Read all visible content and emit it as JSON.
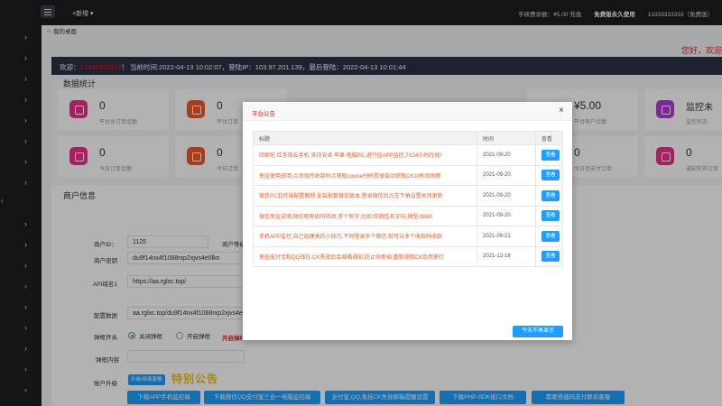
{
  "topbar": {
    "new_label": "+新增 ▾",
    "balance": "手续费余额：¥5.00 充值",
    "free_version": "免费版永久使用",
    "user": "13333333333（免费版）"
  },
  "tabs": {
    "home": "我的桌面"
  },
  "hello": "您好，欢迎",
  "welcome": {
    "prefix": "欢迎：",
    "username": "13333333333",
    "suffix": "！ 当前时间:2022-04-13 10:02:07，登陆IP：103.97.201.139，最后登陆：2022-04-13 10:01:44"
  },
  "stats": {
    "title": "数据统计",
    "cards": [
      {
        "value": "0",
        "label": "平台总订单金额",
        "icon": "bag-icon"
      },
      {
        "value": "0",
        "label": "平台订单",
        "icon": "face-icon"
      },
      {
        "value": "¥5.00",
        "label": "平台账户余额",
        "icon": "wallet-icon"
      },
      {
        "value": "监控未",
        "label": "监控状态",
        "icon": "heart-icon"
      },
      {
        "value": "0",
        "label": "今日订单金额",
        "icon": "bag-icon"
      },
      {
        "value": "0",
        "label": "今日订单",
        "icon": "face-icon"
      },
      {
        "value": "0",
        "label": "今日待支付订单",
        "icon": "clock-icon"
      },
      {
        "value": "0",
        "label": "通知失败订单",
        "icon": "bird-icon"
      }
    ]
  },
  "merchant": {
    "title": "商户信息",
    "id_label": "商户ID：",
    "id_value": "1125",
    "level_label": "商户等级",
    "key_label": "商户密钥",
    "key_value": "du9f14nx4f1088rxp2xjvs4e0lkn",
    "api_label": "API域名1",
    "api_value": "https://aa.rglxc.top/",
    "config_label": "配置数据",
    "config_value": "aa.rglxc.top/du9f14nx4f1088rxp2xjvs4e0",
    "popup_switch_label": "弹框开关",
    "popup_off": "关闭弹框",
    "popup_on": "开启弹框",
    "popup_hint": "开启弹框",
    "popup_content_label": "弹框内容",
    "upgrade_label": "账户升级",
    "upgrade_small": "升级/续费套餐",
    "promo": "特别公告",
    "buttons": [
      "下载APP手机监控端",
      "下载微信QQ支付宝三合一电脑监控端",
      "支付宝,QQ,免挂CK失效邮箱提醒设置",
      "下载PHP-SDK接口文档",
      "需要搭建码支付联系客服"
    ]
  },
  "modal": {
    "title": "平台公告",
    "col_title": "标题",
    "col_time": "时间",
    "col_view": "查看",
    "view_label": "查看",
    "rows": [
      {
        "title": "回家啦 红手指云手机 支持安卓 苹果 电脑PC,进行挂APP监控,7X24小时在线!",
        "time": "2021-09-20"
      },
      {
        "title": "免挂使用说明,点添加传收款码点获取cookie扫码登录自动获取CK10秒后刷新",
        "time": "2021-09-20"
      },
      {
        "title": "微信PC监控端配置教程,安装配套微信版本,登录微信后点左下角设置关闭更新",
        "time": "2021-09-20"
      },
      {
        "title": "微信免挂说明,微信昵称如何修改,手个例字,比如:你微信名字叫,微型-8888",
        "time": "2021-09-20"
      },
      {
        "title": "手机APP监控,自己组建类的小技巧,不同登录多个微信,就可以多个收款码收款",
        "time": "2021-09-21"
      },
      {
        "title": "免挂支付宝和QQ钱包,CK失效后会邮箱通知,防止命断掉,重新获取CK后用使行",
        "time": "2021-12-18"
      }
    ],
    "no_show_label": "今天不再显示"
  }
}
